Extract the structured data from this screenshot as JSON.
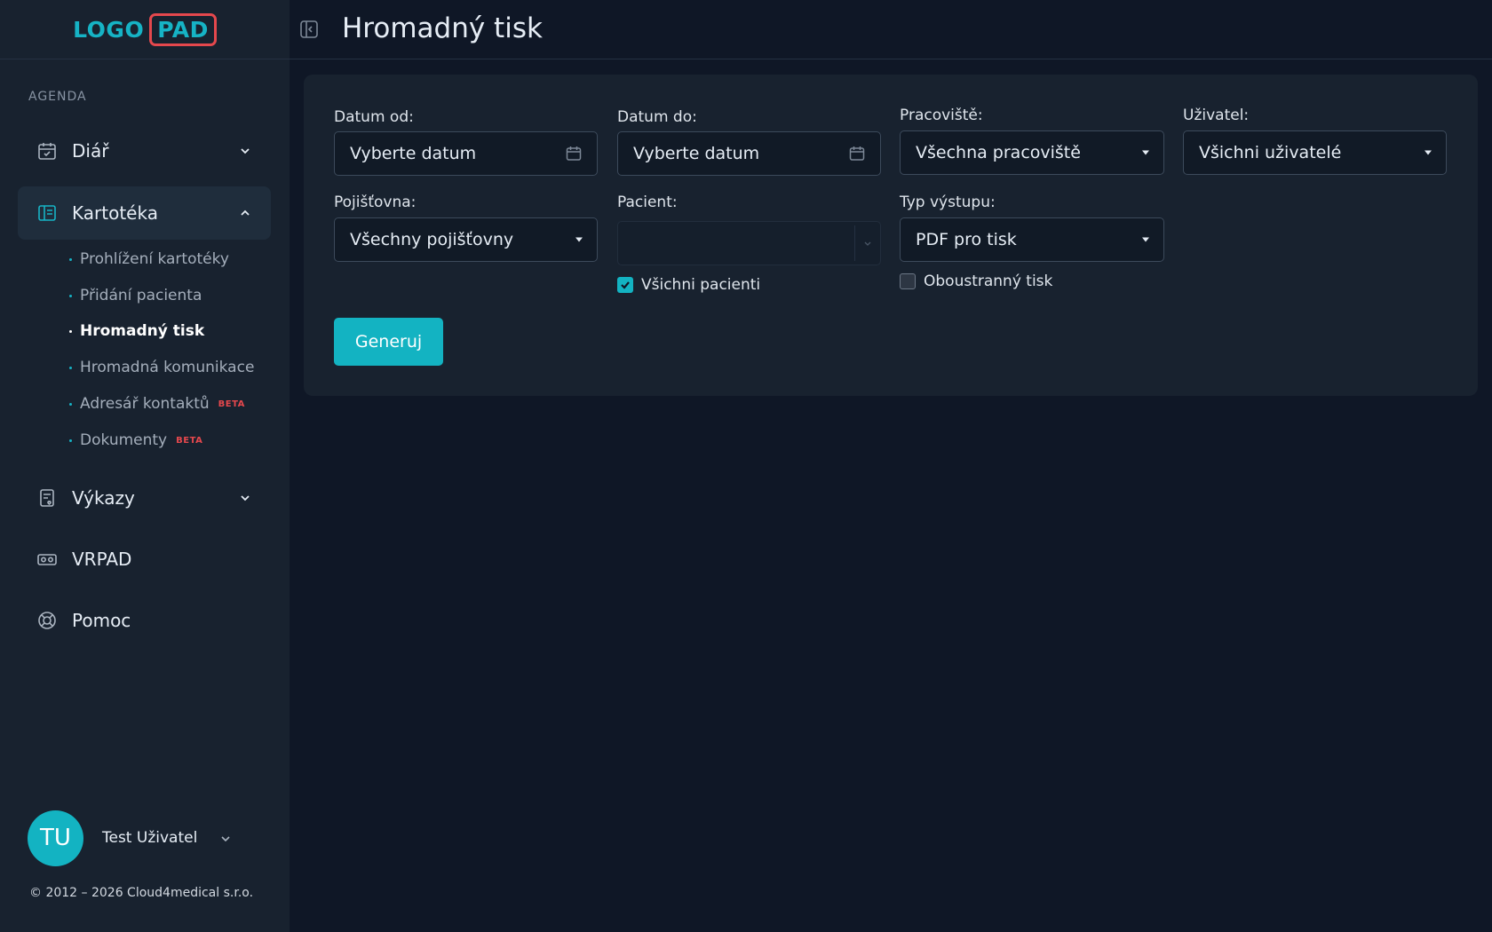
{
  "logo": {
    "part1": "LOGO",
    "part2": "PAD"
  },
  "sidebar": {
    "section_label": "AGENDA",
    "items": [
      {
        "label": "Diář",
        "icon": "calendar-check-icon"
      },
      {
        "label": "Kartotéka",
        "icon": "card-file-icon"
      },
      {
        "label": "Výkazy",
        "icon": "report-icon"
      },
      {
        "label": "VRPAD",
        "icon": "vr-headset-icon"
      },
      {
        "label": "Pomoc",
        "icon": "lifebuoy-icon"
      }
    ],
    "subitems": [
      {
        "label": "Prohlížení kartotéky",
        "badge": ""
      },
      {
        "label": "Přidání pacienta",
        "badge": ""
      },
      {
        "label": "Hromadný tisk",
        "badge": ""
      },
      {
        "label": "Hromadná komunikace",
        "badge": ""
      },
      {
        "label": "Adresář kontaktů",
        "badge": "BETA"
      },
      {
        "label": "Dokumenty",
        "badge": "BETA"
      }
    ],
    "user": {
      "initials": "TU",
      "name": "Test Uživatel"
    },
    "copyright": "© 2012 – 2026 Cloud4medical s.r.o."
  },
  "header": {
    "title": "Hromadný tisk"
  },
  "form": {
    "date_from": {
      "label": "Datum od:",
      "value": "Vyberte datum"
    },
    "date_to": {
      "label": "Datum do:",
      "value": "Vyberte datum"
    },
    "workplace": {
      "label": "Pracoviště:",
      "value": "Všechna pracoviště"
    },
    "user": {
      "label": "Uživatel:",
      "value": "Všichni uživatelé"
    },
    "insurance": {
      "label": "Pojišťovna:",
      "value": "Všechny pojišťovny"
    },
    "patient": {
      "label": "Pacient:",
      "value": ""
    },
    "all_patients": {
      "label": "Všichni pacienti",
      "checked": true
    },
    "output_type": {
      "label": "Typ výstupu:",
      "value": "PDF pro tisk"
    },
    "duplex": {
      "label": "Oboustranný tisk",
      "checked": false
    },
    "generate_label": "Generuj"
  },
  "colors": {
    "accent": "#13b3c2",
    "beta": "#e5484d",
    "background": "#0f1726",
    "sidebar": "#18222f"
  }
}
